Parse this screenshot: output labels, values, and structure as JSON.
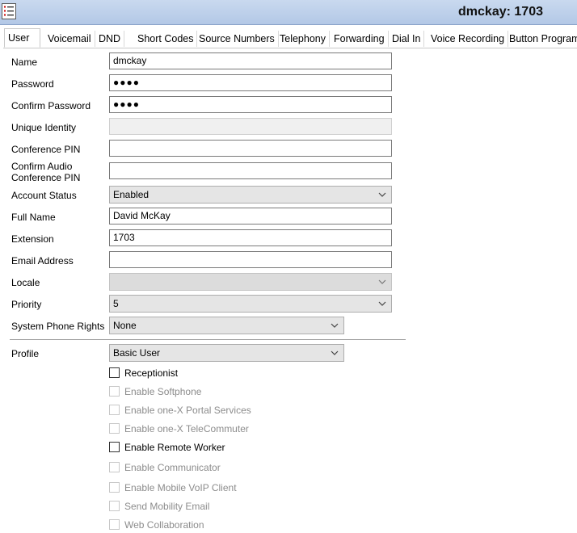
{
  "window": {
    "title": "dmckay: 1703",
    "app_icon": "list-icon"
  },
  "tabs": [
    "User",
    "Voicemail",
    "DND",
    "Short Codes",
    "Source Numbers",
    "Telephony",
    "Forwarding",
    "Dial In",
    "Voice Recording",
    "Button Program"
  ],
  "form": {
    "name": {
      "label": "Name",
      "value": "dmckay"
    },
    "password": {
      "label": "Password",
      "value": "●●●●"
    },
    "confirm_password": {
      "label": "Confirm Password",
      "value": "●●●●"
    },
    "unique_identity": {
      "label": "Unique Identity",
      "value": ""
    },
    "conference_pin": {
      "label": "Conference PIN",
      "value": ""
    },
    "confirm_audio_pin": {
      "label_line1": "Confirm Audio",
      "label_line2": "Conference PIN",
      "value": ""
    },
    "account_status": {
      "label": "Account Status",
      "value": "Enabled"
    },
    "full_name": {
      "label": "Full Name",
      "value": "David McKay"
    },
    "extension": {
      "label": "Extension",
      "value": "1703"
    },
    "email": {
      "label": "Email Address",
      "value": ""
    },
    "locale": {
      "label": "Locale",
      "value": ""
    },
    "priority": {
      "label": "Priority",
      "value": "5"
    },
    "system_phone_rights": {
      "label": "System Phone Rights",
      "value": "None"
    },
    "profile": {
      "label": "Profile",
      "value": "Basic User"
    }
  },
  "checkboxes": [
    {
      "label": "Receptionist",
      "checked": false,
      "enabled": true
    },
    {
      "label": "Enable Softphone",
      "checked": false,
      "enabled": false
    },
    {
      "label": "Enable one-X Portal Services",
      "checked": false,
      "enabled": false
    },
    {
      "label": "Enable one-X TeleCommuter",
      "checked": false,
      "enabled": false
    },
    {
      "label": "Enable Remote Worker",
      "checked": false,
      "enabled": true
    },
    {
      "label": "Enable Communicator",
      "checked": false,
      "enabled": false
    },
    {
      "label": "Enable Mobile VoIP Client",
      "checked": false,
      "enabled": false
    },
    {
      "label": "Send Mobility Email",
      "checked": false,
      "enabled": false
    },
    {
      "label": "Web Collaboration",
      "checked": false,
      "enabled": false
    }
  ]
}
